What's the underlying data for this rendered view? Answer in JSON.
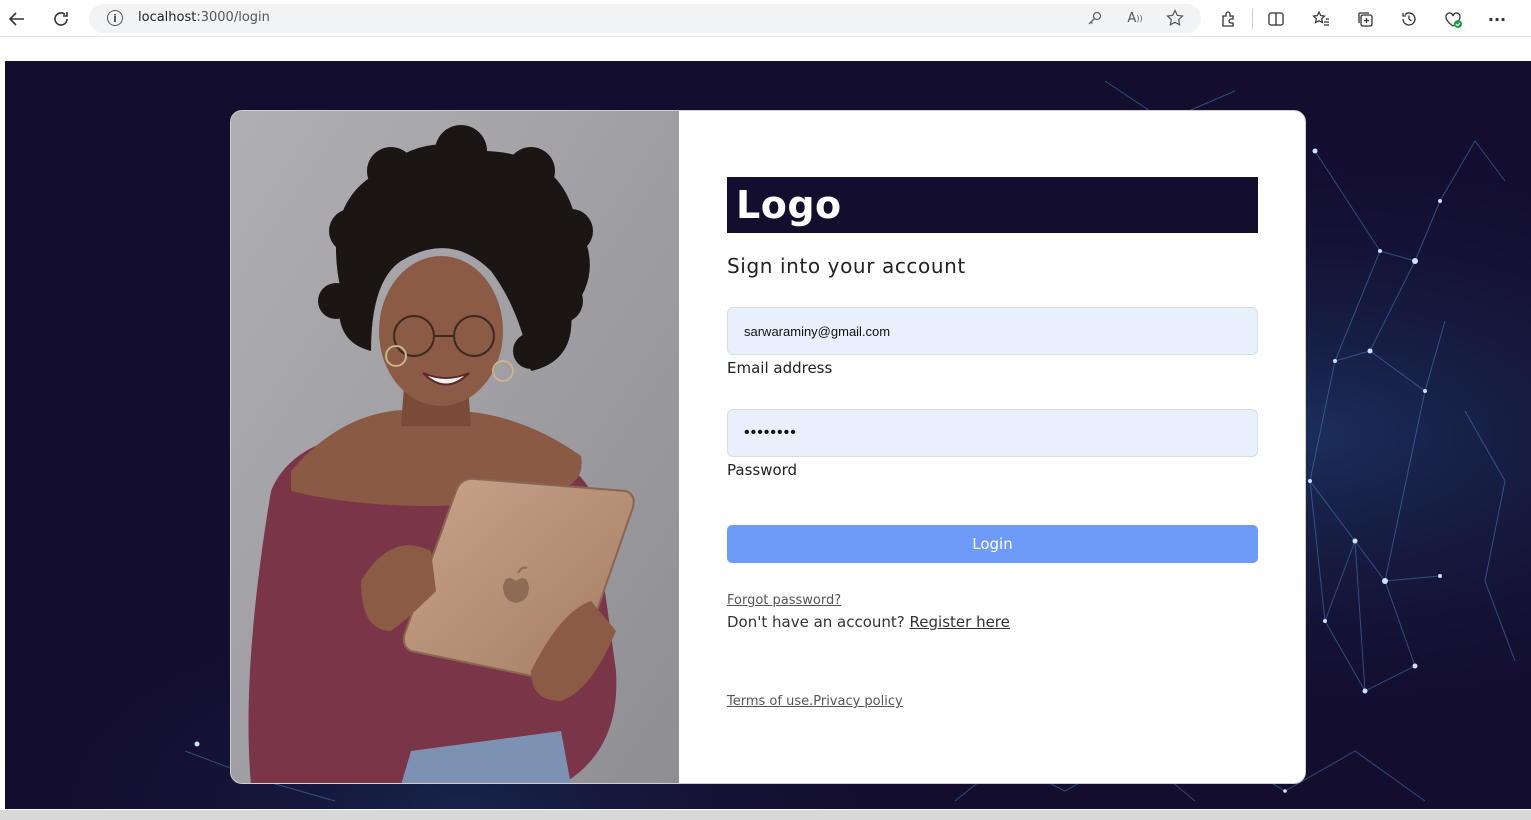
{
  "browser": {
    "url_host": "localhost",
    "url_path": ":3000/login"
  },
  "brand": {
    "logo": "Logo"
  },
  "form": {
    "subtitle": "Sign into your account",
    "email_value": "sarwaraminy@gmail.com",
    "email_label": "Email address",
    "password_value": "••••••••",
    "password_label": "Password",
    "login_label": "Login",
    "forgot_label": "Forgot password?",
    "no_account_text": "Don't have an account? ",
    "register_label": "Register here",
    "terms_label": "Terms of use.",
    "privacy_label": "Privacy policy"
  },
  "colors": {
    "page_background": "#130d2e",
    "button": "#6e9bf7",
    "input_background": "#e8f0fe"
  }
}
